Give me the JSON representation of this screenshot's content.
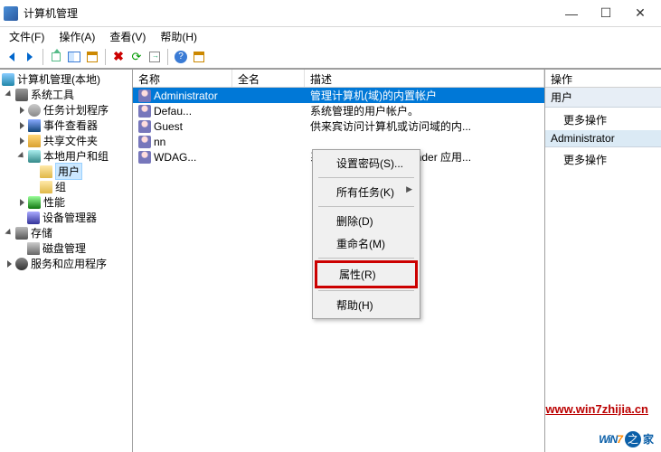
{
  "window": {
    "title": "计算机管理",
    "min": "—",
    "max": "☐",
    "close": "✕"
  },
  "menu": {
    "file": "文件(F)",
    "action": "操作(A)",
    "view": "查看(V)",
    "help": "帮助(H)"
  },
  "tree": {
    "root": "计算机管理(本地)",
    "systools": "系统工具",
    "sched": "任务计划程序",
    "event": "事件查看器",
    "share": "共享文件夹",
    "localusers": "本地用户和组",
    "users": "用户",
    "groups": "组",
    "perf": "性能",
    "dev": "设备管理器",
    "storage": "存储",
    "disk": "磁盘管理",
    "svc": "服务和应用程序"
  },
  "list": {
    "cols": {
      "name": "名称",
      "fullname": "全名",
      "desc": "描述"
    },
    "rows": [
      {
        "name": "Administrator",
        "full": "",
        "desc": "管理计算机(域)的内置帐户"
      },
      {
        "name": "Defau...",
        "full": "",
        "desc": "系统管理的用户帐户。"
      },
      {
        "name": "Guest",
        "full": "",
        "desc": "供来宾访问计算机或访问域的内..."
      },
      {
        "name": "nn",
        "full": "",
        "desc": ""
      },
      {
        "name": "WDAG...",
        "full": "",
        "desc": "系统为 Windows Defender 应用..."
      }
    ]
  },
  "context": {
    "setpw": "设置密码(S)...",
    "alltasks": "所有任务(K)",
    "delete": "删除(D)",
    "rename": "重命名(M)",
    "props": "属性(R)",
    "help": "帮助(H)"
  },
  "actions": {
    "hdr": "操作",
    "sec1": "用户",
    "more1": "更多操作",
    "sec2": "Administrator",
    "more2": "更多操作"
  },
  "watermark": {
    "url": "www.win7zhijia.cn",
    "logo_brand": "WiN",
    "logo_num": "7",
    "circle": "之",
    "tag": "家"
  }
}
